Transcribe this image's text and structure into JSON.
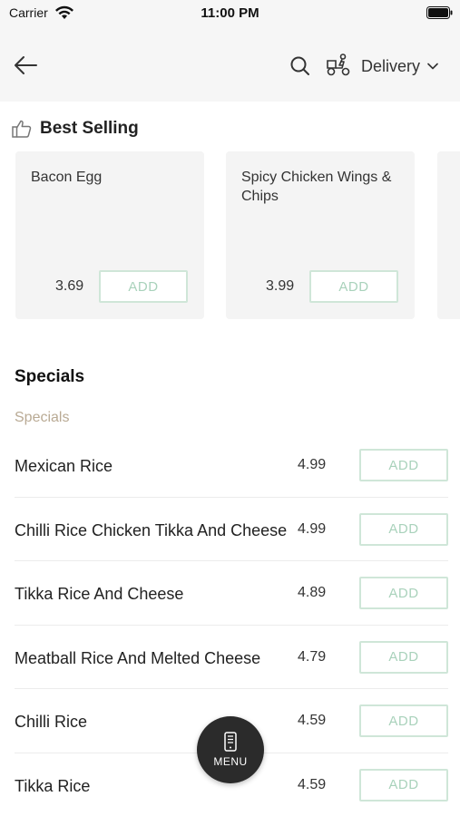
{
  "status_bar": {
    "carrier": "Carrier",
    "time": "11:00 PM"
  },
  "header": {
    "delivery_label": "Delivery",
    "icons": [
      "back-arrow-icon",
      "search-icon",
      "delivery-scooter-icon",
      "chevron-down-icon"
    ]
  },
  "best_selling": {
    "title": "Best Selling",
    "add_label": "ADD",
    "items": [
      {
        "name": "Bacon Egg",
        "price": "3.69"
      },
      {
        "name": "Spicy Chicken Wings & Chips",
        "price": "3.99"
      }
    ]
  },
  "specials": {
    "heading": "Specials",
    "subheading": "Specials",
    "add_label": "ADD",
    "items": [
      {
        "name": "Mexican Rice",
        "price": "4.99"
      },
      {
        "name": "Chilli Rice Chicken Tikka And Cheese",
        "price": "4.99"
      },
      {
        "name": "Tikka Rice And Cheese",
        "price": "4.89"
      },
      {
        "name": "Meatball Rice And Melted Cheese",
        "price": "4.79"
      },
      {
        "name": "Chilli Rice",
        "price": "4.59"
      },
      {
        "name": "Tikka Rice",
        "price": "4.59"
      }
    ]
  },
  "menu_button": {
    "label": "MENU",
    "icon": "menu-phone-icon"
  },
  "colors": {
    "header_bg": "#f6f6f6",
    "card_bg": "#f4f4f4",
    "add_border": "#cfe6d8",
    "add_text": "#a9d2bb",
    "subheading": "#b9aa94",
    "fab_bg": "#2b2b2b"
  }
}
